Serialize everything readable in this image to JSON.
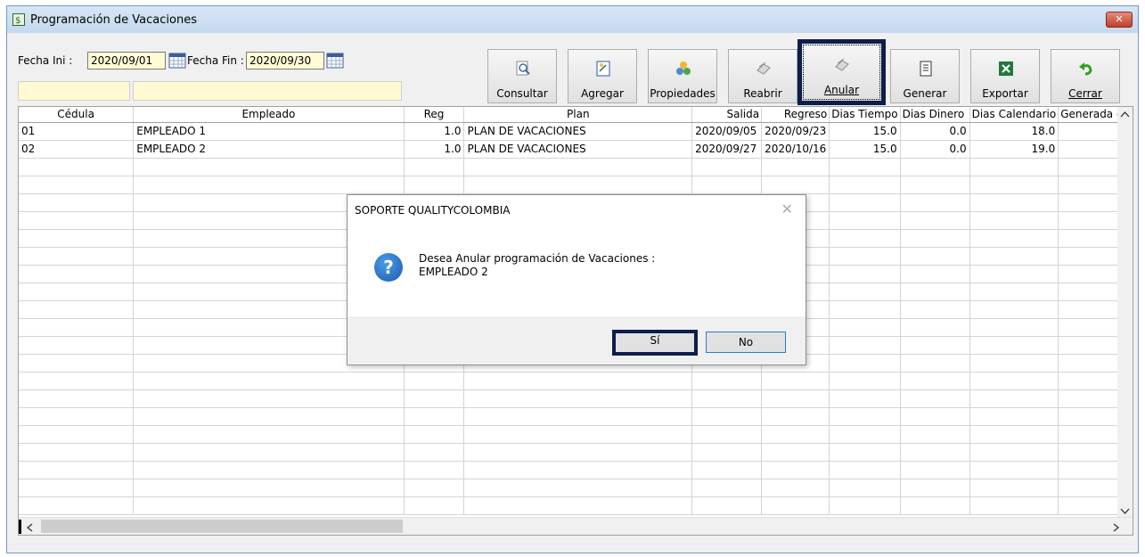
{
  "window": {
    "title": "Programación de Vacaciones",
    "close_label": "✕"
  },
  "filters": {
    "fecha_ini_label": "Fecha Ini :",
    "fecha_ini_value": "2020/09/01",
    "fecha_fin_label": "Fecha Fin :",
    "fecha_fin_value": "2020/09/30"
  },
  "toolbar": {
    "consultar": "Consultar",
    "agregar": "Agregar",
    "propiedades": "Propiedades",
    "reabrir": "Reabrir",
    "anular": "Anular",
    "generar": "Generar",
    "exportar": "Exportar",
    "cerrar": "Cerrar"
  },
  "grid": {
    "columns": [
      "Cédula",
      "Empleado",
      "Reg",
      "Plan",
      "Salida",
      "Regreso",
      "Dias Tiempo",
      "Dias Dinero",
      "Dias Calendario",
      "Generada en"
    ],
    "rows": [
      [
        "01",
        "EMPLEADO 1",
        "1.0",
        "PLAN DE VACACIONES",
        "2020/09/05",
        "2020/09/23",
        "15.0",
        "0.0",
        "18.0",
        ""
      ],
      [
        "02",
        "EMPLEADO 2",
        "1.0",
        "PLAN DE VACACIONES",
        "2020/09/27",
        "2020/10/16",
        "15.0",
        "0.0",
        "19.0",
        ""
      ]
    ]
  },
  "dialog": {
    "title": "SOPORTE QUALITYCOLOMBIA",
    "close": "✕",
    "icon": "?",
    "message_line1": "Desea Anular programación de Vacaciones :",
    "message_line2": "EMPLEADO 2",
    "yes_label": "Sí",
    "no_label": "No"
  }
}
